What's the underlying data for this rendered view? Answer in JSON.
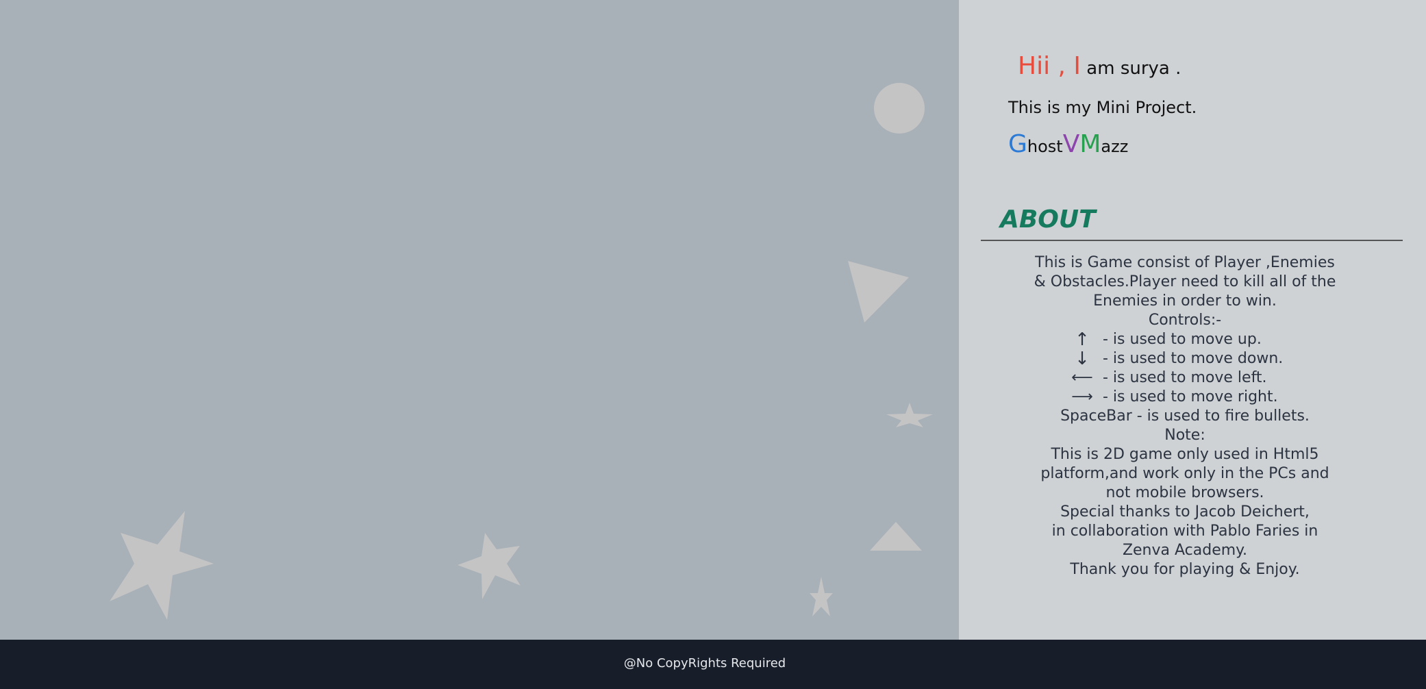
{
  "intro": {
    "hi_accent": "Hii , I",
    "hi_rest": " am surya .",
    "project": "This is my Mini Project.",
    "brand": {
      "g_big": "G",
      "g_rest": "host",
      "v_big": "V",
      "m_big": "M",
      "m_rest": "azz"
    }
  },
  "about": {
    "title": "ABOUT",
    "description_lines": [
      "This is Game consist of Player ,Enemies",
      "& Obstacles.Player need to kill all of the",
      "Enemies in order to win."
    ],
    "controls_heading": "Controls:-",
    "controls": [
      {
        "icon": "arrow-up-icon",
        "glyph": "↑",
        "text": "- is used to move up."
      },
      {
        "icon": "arrow-down-icon",
        "glyph": "↓",
        "text": "- is used to move down."
      },
      {
        "icon": "arrow-left-icon",
        "glyph": "⟵",
        "text": "- is used to move left."
      },
      {
        "icon": "arrow-right-icon",
        "glyph": "⟶",
        "text": "- is used to move right."
      }
    ],
    "spacebar": "SpaceBar - is used to fire bullets.",
    "note_heading": "Note:",
    "note_lines": [
      "This is 2D game only used in Html5",
      "platform,and work only in the PCs and",
      "not mobile browsers.",
      "Special thanks to  Jacob Deichert,",
      "in collaboration with Pablo Faries in",
      "Zenva Academy.",
      "Thank you for playing & Enjoy."
    ]
  },
  "footer": {
    "text": "@No CopyRights Required"
  },
  "colors": {
    "game_bg": "#a8b0b8",
    "panel_bg": "#ced2d5",
    "shape_fill": "#c4c4c4",
    "accent_red": "#e74c3c",
    "about_title": "#157a5e",
    "footer_bg": "#171e2a"
  }
}
